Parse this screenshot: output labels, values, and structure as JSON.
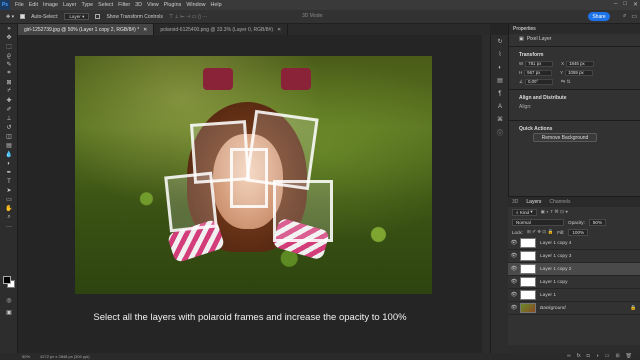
{
  "menu": {
    "items": [
      "File",
      "Edit",
      "Image",
      "Layer",
      "Type",
      "Select",
      "Filter",
      "3D",
      "View",
      "Plugins",
      "Window",
      "Help"
    ]
  },
  "options": {
    "auto_select_label": "Auto-Select:",
    "auto_select_value": "Layer",
    "show_transform_label": "Show Transform Controls",
    "mode3d_label": "3D Mode:",
    "share_label": "Share"
  },
  "tabs": [
    {
      "label": "girl-1252739.jpg @ 50% (Layer 1 copy 2, RGB/8#) *",
      "active": true
    },
    {
      "label": "polaroid-6125400.png @ 33.3% (Layer 0, RGB/8#)",
      "active": false
    }
  ],
  "caption": "Select all the layers with polaroid frames and increase the opacity to 100%",
  "status": {
    "zoom": "50%",
    "doc_info": "4272 px x 2848 px (300 ppi)"
  },
  "properties": {
    "tab_label": "Properties",
    "layer_kind": "Pixel Layer",
    "transform_title": "Transform",
    "w_label": "W",
    "w_value": "781 px",
    "x_label": "X",
    "x_value": "1845 px",
    "h_label": "H",
    "h_value": "967 px",
    "y_label": "Y",
    "y_value": "1059 px",
    "angle_value": "0,00°",
    "align_title": "Align and Distribute",
    "align_label": "Align:",
    "quick_title": "Quick Actions",
    "remove_bg_label": "Remove Background"
  },
  "layers_panel": {
    "tabs": [
      "3D",
      "Layers",
      "Channels"
    ],
    "active_tab": "Layers",
    "kind_label": "Kind",
    "blend_mode": "Normal",
    "opacity_label": "Opacity:",
    "opacity_value": "50%",
    "lock_label": "Lock:",
    "fill_label": "Fill:",
    "fill_value": "100%",
    "layers": [
      {
        "name": "Layer 1 copy 4",
        "selected": false
      },
      {
        "name": "Layer 1 copy 3",
        "selected": false
      },
      {
        "name": "Layer 1 copy 2",
        "selected": true
      },
      {
        "name": "Layer 1 copy",
        "selected": false
      },
      {
        "name": "Layer 1",
        "selected": false
      },
      {
        "name": "Background",
        "selected": false,
        "locked": true
      }
    ]
  },
  "icons": {
    "logo": "photoshop-logo",
    "move_tool": "move-icon"
  },
  "colors": {
    "accent": "#1f73e8",
    "app_bg": "#252525",
    "panel_bg": "#323232"
  }
}
